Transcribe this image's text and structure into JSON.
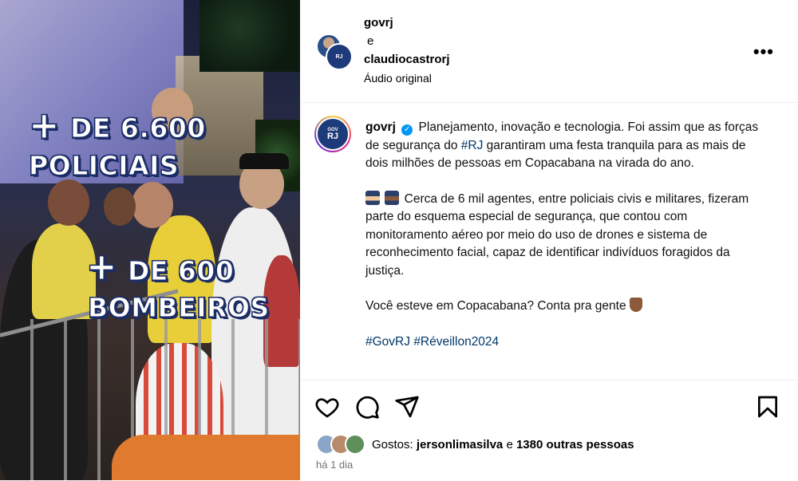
{
  "media": {
    "overlay_line1_plus": "+",
    "overlay_line1": "DE 6.600",
    "overlay_line2": "POLICIAIS",
    "overlay_line3_plus": "+",
    "overlay_line3": "DE 600",
    "overlay_line4": "BOMBEIROS"
  },
  "header": {
    "user1": "govrj",
    "conjunction": "e",
    "user2": "claudiocastrorj",
    "audio": "Áudio original",
    "avatar_badge": "RJ",
    "more_label": "•••"
  },
  "caption": {
    "username": "govrj",
    "avatar_top": "GOV",
    "avatar_bottom": "RJ",
    "p1_a": "Planejamento, inovação e tecnologia. Foi assim que as forças de segurança do ",
    "p1_tag": "#RJ",
    "p1_b": " garantiram uma festa tranquila para as mais de dois milhões de pessoas em Copacabana na virada do ano.",
    "p2": "Cerca de 6 mil agentes, entre policiais civis e militares, fizeram parte do esquema especial de segurança, que contou com monitoramento aéreo por meio do uso de drones e sistema de reconhecimento facial, capaz de identificar indivíduos foragidos da justiça.",
    "p3": "Você esteve em Copacabana? Conta pra gente",
    "tag1": "#GovRJ",
    "tag2": "#Réveillon2024"
  },
  "actions": {
    "likes_prefix": "Gostos:",
    "likes_user": "jersonlimasilva",
    "likes_and": "e",
    "likes_others": "1380 outras pessoas",
    "time": "há 1 dia"
  },
  "icons": [
    "heart-icon",
    "comment-icon",
    "share-icon",
    "bookmark-icon",
    "more-icon",
    "verified-icon"
  ]
}
